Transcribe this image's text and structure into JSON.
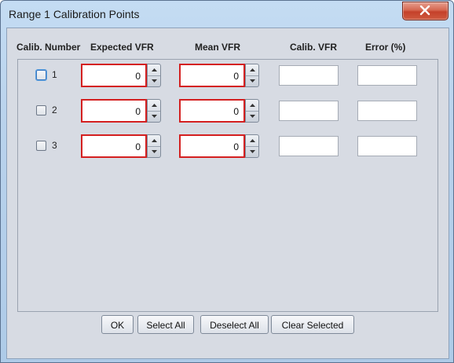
{
  "window": {
    "title": "Range 1 Calibration Points"
  },
  "columns": {
    "calib_number": "Calib. Number",
    "expected_vfr": "Expected VFR",
    "mean_vfr": "Mean VFR",
    "calib_vfr": "Calib. VFR",
    "error": "Error (%)"
  },
  "rows": [
    {
      "number": "1",
      "expected": "0",
      "mean": "0",
      "calib": "",
      "error": ""
    },
    {
      "number": "2",
      "expected": "0",
      "mean": "0",
      "calib": "",
      "error": ""
    },
    {
      "number": "3",
      "expected": "0",
      "mean": "0",
      "calib": "",
      "error": ""
    }
  ],
  "buttons": {
    "ok": "OK",
    "select_all": "Select All",
    "deselect_all": "Deselect All",
    "clear_selected": "Clear Selected"
  },
  "colors": {
    "invalid_border": "#d42020",
    "close_button": "#c4412a",
    "panel_background": "#d7dbe3"
  }
}
